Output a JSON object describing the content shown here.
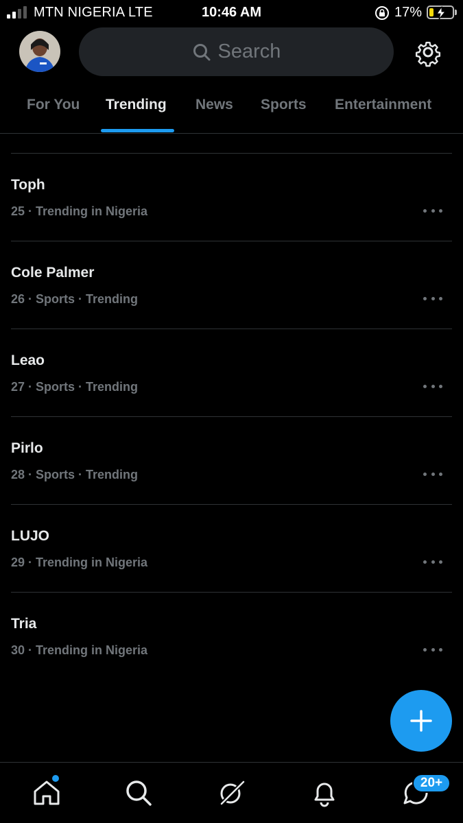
{
  "status_bar": {
    "carrier": "MTN NIGERIA  LTE",
    "time": "10:46 AM",
    "battery_percent": "17%",
    "battery_level": 0.17,
    "icons": [
      "signal-icon",
      "rotation-lock-icon",
      "battery-charging-icon"
    ]
  },
  "header": {
    "search_placeholder": "Search",
    "icons": [
      "avatar",
      "search-icon",
      "settings-gear-icon"
    ]
  },
  "tabs": [
    {
      "label": "For You",
      "active": false
    },
    {
      "label": "Trending",
      "active": true
    },
    {
      "label": "News",
      "active": false
    },
    {
      "label": "Sports",
      "active": false
    },
    {
      "label": "Entertainment",
      "active": false
    }
  ],
  "trends": [
    {
      "title": "Toph",
      "meta": "25 · Trending in Nigeria"
    },
    {
      "title": "Cole Palmer",
      "meta": "26 · Sports · Trending"
    },
    {
      "title": "Leao",
      "meta": "27 · Sports · Trending"
    },
    {
      "title": "Pirlo",
      "meta": "28 · Sports · Trending"
    },
    {
      "title": "LUJO",
      "meta": "29 · Trending in Nigeria"
    },
    {
      "title": "Tria",
      "meta": "30 · Trending in Nigeria"
    }
  ],
  "bottom_nav": {
    "items": [
      "home-icon",
      "search-icon",
      "grok-icon",
      "notifications-bell-icon",
      "messages-icon"
    ],
    "messages_badge": "20+"
  },
  "colors": {
    "accent": "#1d9bf0",
    "background": "#000000",
    "primary_text": "#e7e9ea",
    "secondary_text": "#71767b",
    "divider": "#2f3336"
  }
}
